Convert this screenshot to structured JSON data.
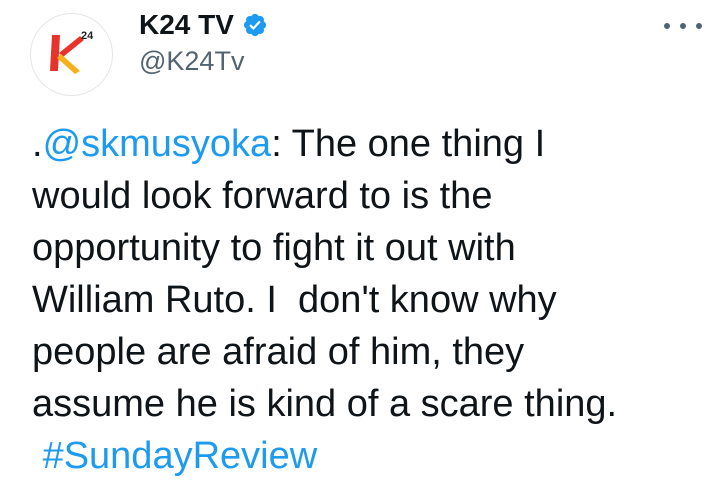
{
  "tweet": {
    "display_name": "K24 TV",
    "handle": "@K24Tv",
    "verified_icon": "verified-badge-icon",
    "more_icon": "more-options-icon",
    "body": {
      "prefix": ".",
      "mention": "@skmusyoka",
      "line1_rest": ": The one thing I",
      "line2": "would look forward to is the",
      "line3": "opportunity to fight it out with",
      "line4": "William Ruto. I  don't know why",
      "line5": "people are afraid of him, they",
      "line6": "assume he is kind of a scare thing.",
      "line7_lead": " ",
      "hashtag": "#SundayReview"
    },
    "avatar": {
      "logo_text": "24",
      "logo_name": "k24-logo-icon"
    }
  },
  "colors": {
    "text": "#0f1419",
    "secondary": "#536471",
    "link": "#1d9bf0",
    "verified": "#1d9bf0",
    "logo_red": "#e8332a",
    "logo_yellow": "#f6b21b"
  }
}
